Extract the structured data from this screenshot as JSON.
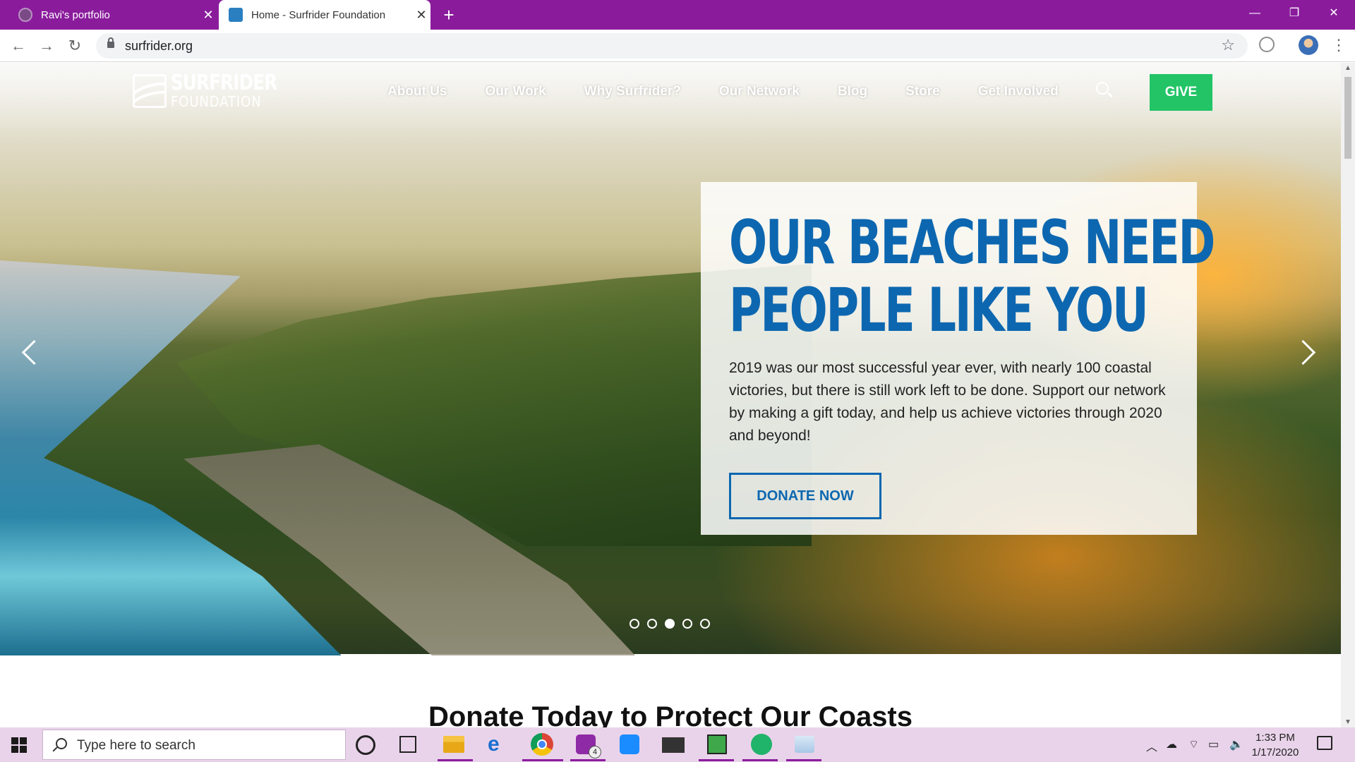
{
  "browser": {
    "tabs": [
      {
        "title": "Ravi's portfolio",
        "active": false
      },
      {
        "title": "Home - Surfrider Foundation",
        "active": true
      }
    ],
    "url": "surfrider.org"
  },
  "site": {
    "logo": {
      "line1": "SURFRIDER",
      "line2": "FOUNDATION"
    },
    "nav": [
      "About Us",
      "Our Work",
      "Why Surfrider?",
      "Our Network",
      "Blog",
      "Store",
      "Get Involved"
    ],
    "give_label": "GIVE"
  },
  "hero": {
    "heading_line1": "OUR BEACHES NEED",
    "heading_line2": "PEOPLE LIKE YOU",
    "body": "2019 was our most successful year ever, with nearly 100 coastal victories, but there is still work left to be done. Support our network by making a gift today, and help us achieve victories through 2020 and beyond!",
    "cta": "DONATE NOW",
    "slide_count": 5,
    "active_slide": 3
  },
  "section": {
    "title": "Donate Today to Protect Our Coasts"
  },
  "taskbar": {
    "search_placeholder": "Type here to search",
    "instagram_badge": "4",
    "time": "1:33 PM",
    "date": "1/17/2020"
  },
  "colors": {
    "tab_strip": "#8a1c9c",
    "brand_blue": "#0d67b0",
    "give_green": "#22c466"
  }
}
